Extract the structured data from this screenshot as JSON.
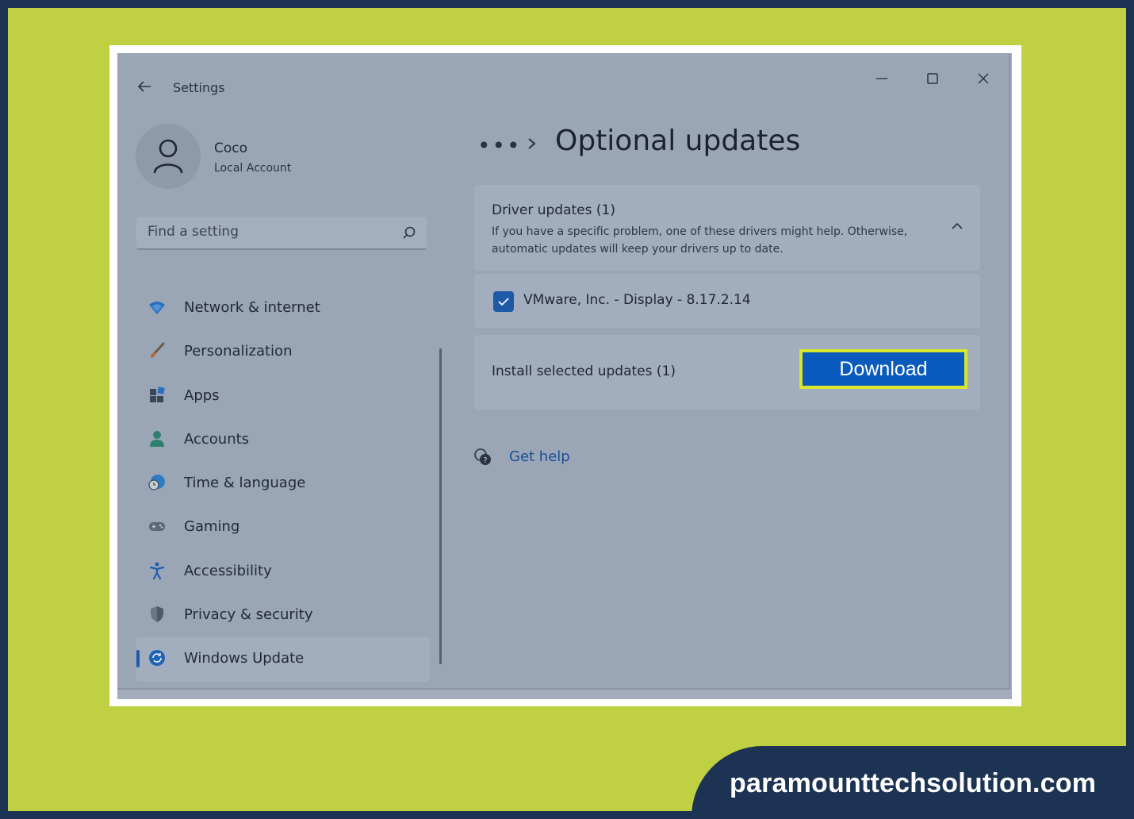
{
  "window": {
    "title": "Settings"
  },
  "user": {
    "name": "Coco",
    "account_type": "Local Account"
  },
  "search": {
    "placeholder": "Find a setting"
  },
  "sidebar": {
    "items": [
      {
        "label": "Network & internet",
        "icon": "wifi-icon"
      },
      {
        "label": "Personalization",
        "icon": "brush-icon"
      },
      {
        "label": "Apps",
        "icon": "apps-icon"
      },
      {
        "label": "Accounts",
        "icon": "person-icon"
      },
      {
        "label": "Time & language",
        "icon": "globe-clock-icon"
      },
      {
        "label": "Gaming",
        "icon": "gamepad-icon"
      },
      {
        "label": "Accessibility",
        "icon": "accessibility-icon"
      },
      {
        "label": "Privacy & security",
        "icon": "shield-icon"
      },
      {
        "label": "Windows Update",
        "icon": "update-icon",
        "active": true
      }
    ]
  },
  "breadcrumb": {
    "ellipsis": "•••",
    "page_title": "Optional updates"
  },
  "driver_updates": {
    "title": "Driver updates (1)",
    "description": "If you have a specific problem, one of these drivers might help. Otherwise, automatic updates will keep your drivers up to date.",
    "items": [
      {
        "label": "VMware, Inc. - Display - 8.17.2.14",
        "checked": true
      }
    ]
  },
  "install": {
    "label": "Install selected updates (1)",
    "button_label": "Download"
  },
  "help": {
    "label": "Get help"
  },
  "branding": {
    "site": "paramounttechsolution.com"
  },
  "colors": {
    "accent": "#0a5bbd",
    "highlight": "#d9e62a",
    "frame_lime": "#bfd043",
    "frame_navy": "#1d3354"
  }
}
